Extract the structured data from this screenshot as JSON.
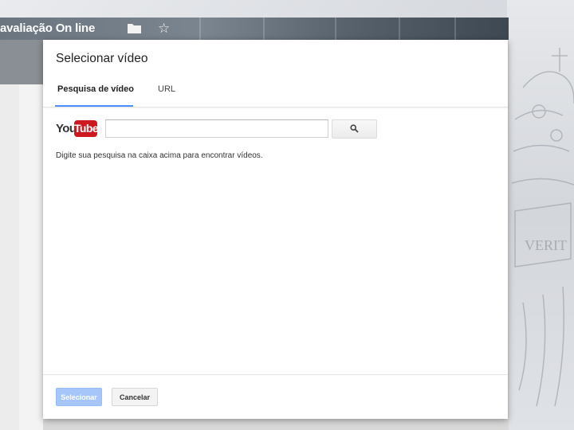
{
  "window": {
    "doc_title": "avaliação On line",
    "folder_icon": "folder-icon",
    "star_icon": "star-icon"
  },
  "dialog": {
    "title": "Selecionar vídeo",
    "tabs": [
      {
        "label": "Pesquisa de vídeo",
        "active": true
      },
      {
        "label": "URL",
        "active": false
      }
    ],
    "youtube_logo": {
      "you": "You",
      "tube": "Tube",
      "icon": "youtube-logo"
    },
    "search": {
      "value": "",
      "placeholder": "",
      "button_icon": "search-icon"
    },
    "hint": "Digite sua pesquisa na caixa acima para encontrar vídeos.",
    "buttons": {
      "select_label": "Selecionar",
      "cancel_label": "Cancelar"
    }
  },
  "background": {
    "watermark_text": "VERIT"
  },
  "colors": {
    "accent": "#4d90fe",
    "youtube_red": "#cc181e",
    "disabled_primary": "#a6c6fa"
  }
}
